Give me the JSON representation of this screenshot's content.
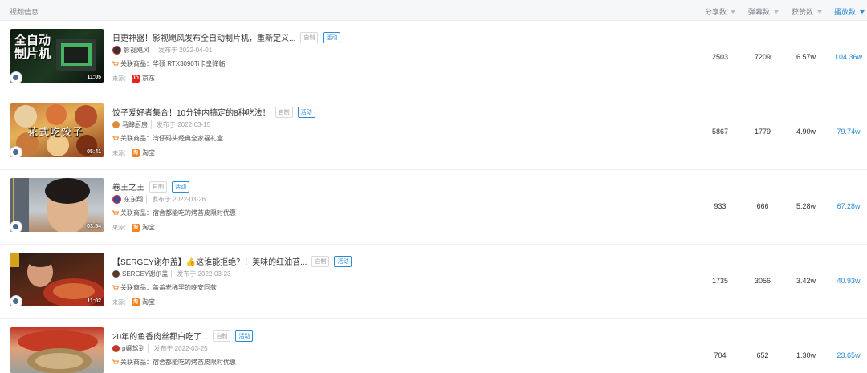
{
  "header": {
    "video_info": "视频信息",
    "share": "分享数",
    "danmu": "弹幕数",
    "likes": "获赞数",
    "plays": "播放数"
  },
  "colors": {
    "accent": "#2a8bd8",
    "orange": "#f58220"
  },
  "rows": [
    {
      "title": "日更神器！影视飓风发布全自动制片机，重新定义...",
      "tag_self": "自制",
      "tag_activity": "活动",
      "author": "影视飓风",
      "published": "发布于 2022-04-01",
      "goods_prefix": "关联商品：",
      "goods": "华硕 RTX3090Ti卡皇降临!",
      "source_label": "来源：",
      "source_name": "京东",
      "source_logo": "JD",
      "duration": "11:05",
      "thumb_text": "全自动 制片机",
      "share": "2503",
      "danmu": "7209",
      "likes": "6.57w",
      "plays": "104.36w"
    },
    {
      "title": "饺子爱好者集合！10分钟内搞定的8种吃法！",
      "tag_self": "自制",
      "tag_activity": "活动",
      "author": "马蹄厨房",
      "published": "发布于 2022-03-15",
      "goods_prefix": "关联商品：",
      "goods": "湾仔码头经典全家福礼盒",
      "source_label": "来源：",
      "source_name": "淘宝",
      "source_logo": "淘",
      "duration": "05:41",
      "thumb_text": "花式吃饺子",
      "share": "5867",
      "danmu": "1779",
      "likes": "4.90w",
      "plays": "79.74w"
    },
    {
      "title": "卷王之王",
      "tag_self": "自制",
      "tag_activity": "活动",
      "author": "东东翔",
      "published": "发布于 2022-03-26",
      "goods_prefix": "关联商品：",
      "goods": "宿舍都能吃的烤苔皮限时优惠",
      "source_label": "来源：",
      "source_name": "淘宝",
      "source_logo": "淘",
      "duration": "03:54",
      "thumb_text": "",
      "share": "933",
      "danmu": "666",
      "likes": "5.28w",
      "plays": "67.28w"
    },
    {
      "title": "【SERGEY谢尔盖】👍这谁能拒绝？！美味的红油苔...",
      "tag_self": "自制",
      "tag_activity": "活动",
      "author": "SERGEY谢尔盖",
      "published": "发布于 2022-03-23",
      "goods_prefix": "关联商品：",
      "goods": "盖盖老稀罕的晚安同款",
      "source_label": "来源：",
      "source_name": "淘宝",
      "source_logo": "淘",
      "duration": "11:02",
      "thumb_text": "",
      "share": "1735",
      "danmu": "3056",
      "likes": "3.42w",
      "plays": "40.93w"
    },
    {
      "title": "20年的鱼香肉丝都白吃了...",
      "tag_self": "自制",
      "tag_activity": "活动",
      "author": "p嬢驾到",
      "published": "发布于 2022-03-25",
      "goods_prefix": "关联商品：",
      "goods": "宿舍都能吃的烤苔皮限时优惠",
      "source_label": "来源：",
      "source_name": "",
      "source_logo": "",
      "duration": "",
      "thumb_text": "",
      "share": "704",
      "danmu": "652",
      "likes": "1.30w",
      "plays": "23.65w"
    }
  ]
}
